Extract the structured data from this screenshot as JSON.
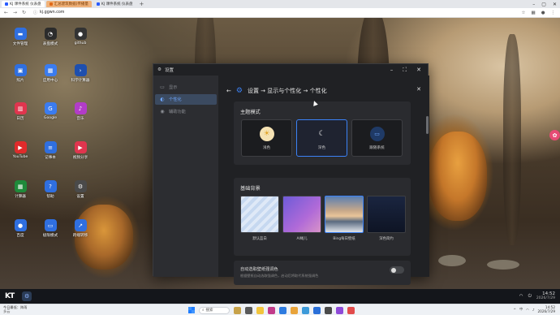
{
  "browser": {
    "tabs": [
      {
        "label": "KJ 课件系统 仪表盘",
        "active": true
      },
      {
        "label": "汇总建筑数据(传播量",
        "active": false,
        "style": "orange"
      },
      {
        "label": "KJ 课件系统 仪表盘",
        "active": false
      }
    ],
    "new_tab": "+",
    "url": "kj.ggwn.com"
  },
  "desktop": {
    "icons": [
      {
        "label": "文件管理",
        "icon": "folder-icon",
        "color": "#2f6fe0",
        "glyph": "▬"
      },
      {
        "label": "表盘模式",
        "icon": "clock-icon",
        "color": "#2c2c2c",
        "glyph": "◔"
      },
      {
        "label": "github",
        "icon": "github-icon",
        "color": "#333",
        "glyph": "●"
      },
      {
        "label": "照片",
        "icon": "photos-icon",
        "color": "#2f6fe0",
        "glyph": "▣"
      },
      {
        "label": "应用中心",
        "icon": "store-icon",
        "color": "#3a7cf0",
        "glyph": "▦"
      },
      {
        "label": "科学计算器",
        "icon": "terminal-icon",
        "color": "#1e4fae",
        "glyph": "›"
      },
      {
        "label": "日历",
        "icon": "calendar-icon",
        "color": "#e0354e",
        "glyph": "▥"
      },
      {
        "label": "Google",
        "icon": "google-icon",
        "color": "#3b7cf0",
        "glyph": "G"
      },
      {
        "label": "音乐",
        "icon": "music-icon",
        "color": "#b23cc8",
        "glyph": "♪"
      },
      {
        "label": "YouTube",
        "icon": "youtube-icon",
        "color": "#e02b2b",
        "glyph": "▶"
      },
      {
        "label": "记事本",
        "icon": "notepad-icon",
        "color": "#2f6fe0",
        "glyph": "≡"
      },
      {
        "label": "视频分享",
        "icon": "video-icon",
        "color": "#e0354e",
        "glyph": "▶"
      },
      {
        "label": "计算器",
        "icon": "calculator-icon",
        "color": "#1f8a3a",
        "glyph": "▦"
      },
      {
        "label": "帮助",
        "icon": "help-icon",
        "color": "#2f6fe0",
        "glyph": "?"
      },
      {
        "label": "设置",
        "icon": "settings-icon",
        "color": "#4a4a4a",
        "glyph": "⚙"
      },
      {
        "label": "百度",
        "icon": "baidu-icon",
        "color": "#2f6fe0",
        "glyph": "●"
      },
      {
        "label": "极限模式",
        "icon": "extreme-mode-icon",
        "color": "#2f6fe0",
        "glyph": "▭"
      },
      {
        "label": "跨端转移",
        "icon": "transfer-icon",
        "color": "#2f6fe0",
        "glyph": "↗"
      }
    ]
  },
  "settings": {
    "window_title": "设置",
    "sidebar": [
      {
        "label": "显示",
        "icon": "monitor-icon",
        "active": false
      },
      {
        "label": "个性化",
        "icon": "brush-icon",
        "active": true
      },
      {
        "label": "辅助功能",
        "icon": "accessibility-icon",
        "active": false
      }
    ],
    "breadcrumb": "设置 → 显示与个性化 → 个性化",
    "theme": {
      "title": "主题模式",
      "options": [
        {
          "label": "浅色",
          "icon": "sun-icon",
          "selected": false
        },
        {
          "label": "深色",
          "icon": "moon-icon",
          "selected": true
        },
        {
          "label": "跟随系统",
          "icon": "monitor-icon",
          "selected": false
        }
      ]
    },
    "background": {
      "title": "基础背景",
      "options": [
        {
          "label": "默认蓝白",
          "selected": false
        },
        {
          "label": "AI绳儿",
          "selected": false
        },
        {
          "label": "Bing每日壁纸",
          "selected": true
        },
        {
          "label": "深色简约",
          "selected": false
        }
      ]
    },
    "auto_color": {
      "title": "自动选取壁纸强调色",
      "desc": "根据壁纸自动选取强调色，启动后将取代系统强调色",
      "enabled": false
    }
  },
  "dock": {
    "logo": "KT",
    "time": "14:52",
    "date": "2026/7/29"
  },
  "taskbar": {
    "weather_line1": "今日最低：阵雨",
    "weather_line2": "多云",
    "search_placeholder": "搜索",
    "lang": "中",
    "time": "14:52",
    "date": "2026/7/29"
  }
}
